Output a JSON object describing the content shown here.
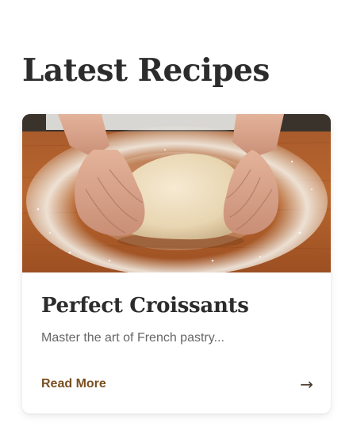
{
  "section": {
    "title": "Latest Recipes"
  },
  "recipes": [
    {
      "title": "Perfect Croissants",
      "description": "Master the art of French pastry...",
      "link_label": "Read More",
      "arrow_glyph": "→",
      "image_icon": "dough-kneading-photo"
    }
  ],
  "colors": {
    "accent": "#7a4f22",
    "heading": "#2c2c2c",
    "body_text": "#666666"
  }
}
